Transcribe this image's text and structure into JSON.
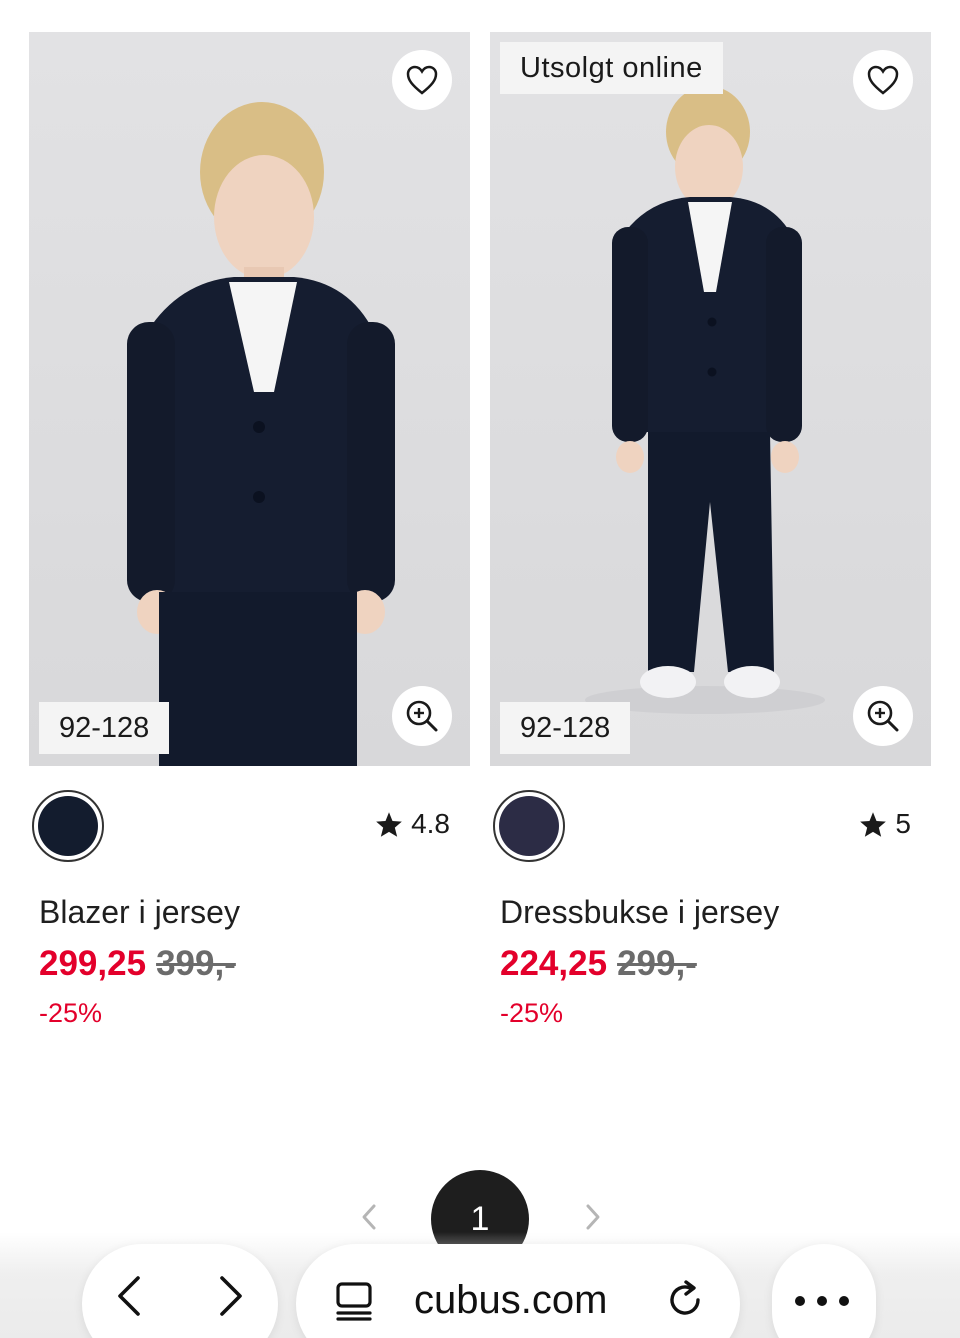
{
  "products": [
    {
      "name": "Blazer i jersey",
      "price_now": "299,25",
      "price_old": "399,-",
      "discount": "-25%",
      "size_range": "92-128",
      "rating": "4.8",
      "badge": "",
      "swatch_color": "#131c2e"
    },
    {
      "name": "Dressbukse i jersey",
      "price_now": "224,25",
      "price_old": "299,-",
      "discount": "-25%",
      "size_range": "92-128",
      "rating": "5",
      "badge": "Utsolgt online",
      "swatch_color": "#2c2c45"
    }
  ],
  "pagination": {
    "current_page": "1",
    "prev_icon": "chevron-left-icon",
    "next_icon": "chevron-right-icon"
  },
  "browser": {
    "url": "cubus.com",
    "icons": [
      "back-icon",
      "forward-icon",
      "tabs-icon",
      "reload-icon",
      "more-icon"
    ]
  },
  "colors": {
    "sale_red": "#e3002b",
    "garment_navy": "#151d30"
  }
}
